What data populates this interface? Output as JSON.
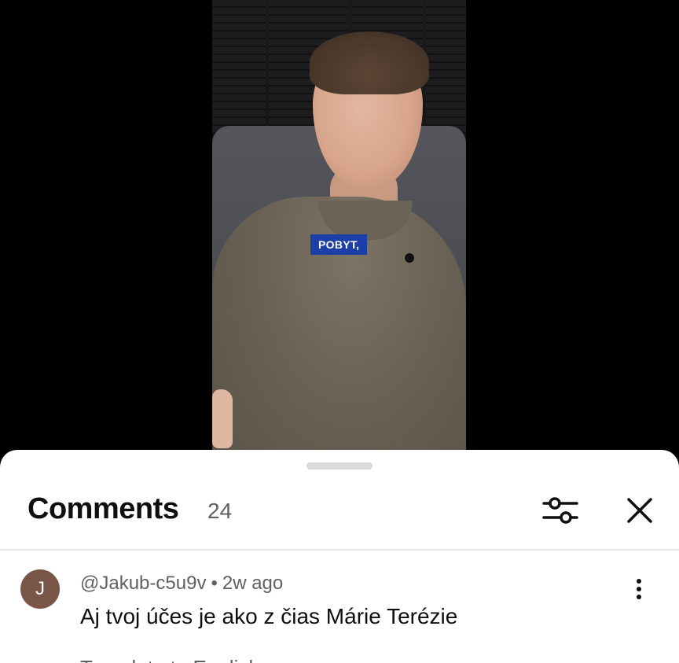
{
  "video": {
    "caption": "POBYT,"
  },
  "comments_sheet": {
    "title": "Comments",
    "count": "24",
    "icons": {
      "filter": "sort-filter-icon",
      "close": "close-icon",
      "more": "more-vert-icon"
    },
    "items": [
      {
        "avatar_letter": "J",
        "avatar_color": "#795548",
        "author": "@Jakub-c5u9v",
        "separator": "•",
        "time": "2w ago",
        "text": "Aj tvoj účes je ako z čias Márie Terézie",
        "translate_label": "Translate to English"
      }
    ]
  }
}
